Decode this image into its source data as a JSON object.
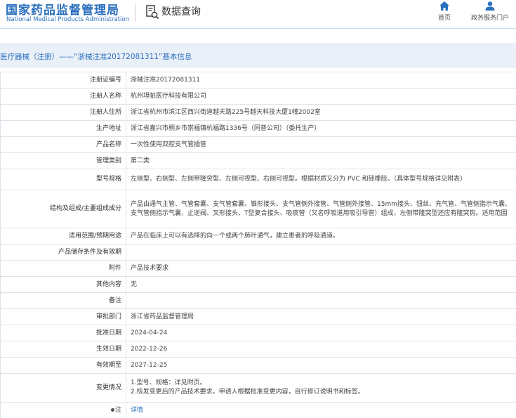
{
  "header": {
    "logo_cn": "国家药品监督管理局",
    "logo_en": "National Medical Products Administration",
    "data_title": "数据查询",
    "nav": [
      {
        "label": "首页",
        "icon": "home-icon"
      },
      {
        "label": "政务服务门户",
        "icon": "user-icon"
      }
    ]
  },
  "page_title": "医疗器械（注册）——“浙械注准20172081311”基本信息",
  "rows": [
    {
      "label": "注册证编号",
      "value": "浙械注准20172081311"
    },
    {
      "label": "注册人名称",
      "value": "杭州坦帕医疗科技有限公司"
    },
    {
      "label": "注册人住所",
      "value": "浙江省杭州市滨江区西兴街道越天路225号越天科技大厦1幢2002室"
    },
    {
      "label": "生产地址",
      "value": "浙江省嘉兴市桐乡市崇福镇杭福路1336号（同普公司）（委托生产）"
    },
    {
      "label": "产品名称",
      "value": "一次性使用双腔支气管插管"
    },
    {
      "label": "管理类别",
      "value": "第二类"
    },
    {
      "label": "型号规格",
      "value": "左侧型、右侧型、左侧带隆突型、左侧可视型、右侧可视型。根据材质又分为 PVC 和硅橡胶。（具体型号规格详见附表）"
    },
    {
      "label": "结构及组成/主要组成成分",
      "value": "产品由通气主管、气管套囊、支气管套囊、锥形接头、支气管侧外接管、气管侧外接管、15mm接头、钮丝、充气管、气管侧指示气囊、支气管侧指示气囊、止逆阀、叉形接头、T型复合接头、吸痰管（又名呼吸道用吸引导管）组成，左侧带隆突型还应有隆突钩。适用范围"
    },
    {
      "label": "适用范围/预期用途",
      "value": "产品在临床上可以有选择的向一个或两个肺叶通气，建立患者的呼吸通道。"
    },
    {
      "label": "产品储存条件及有效期",
      "value": ""
    },
    {
      "label": "附件",
      "value": "产品技术要求"
    },
    {
      "label": "其他内容",
      "value": "无"
    },
    {
      "label": "备注",
      "value": ""
    },
    {
      "label": "审批部门",
      "value": "浙江省药品监督管理局"
    },
    {
      "label": "批准日期",
      "value": "2024-04-24"
    },
    {
      "label": "生效日期",
      "value": "2022-12-26"
    },
    {
      "label": "有效期至",
      "value": "2027-12-25"
    },
    {
      "label": "变更情况",
      "value_lines": [
        "1.型号、规格：详见附页。",
        "2.核发变更后的产品技术要求。申请人根据批准变更内容，自行修订说明书和标签。"
      ]
    },
    {
      "label": "注",
      "value": "详情"
    }
  ]
}
